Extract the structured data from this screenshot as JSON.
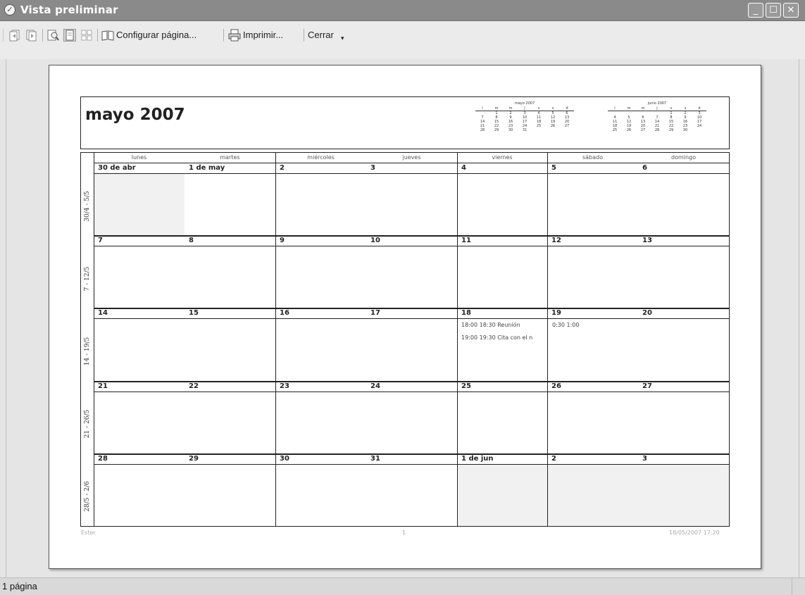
{
  "window": {
    "title": "Vista preliminar"
  },
  "toolbar": {
    "page_setup": "Configurar página...",
    "print": "Imprimir...",
    "close": "Cerrar"
  },
  "calendar": {
    "title": "mayo 2007",
    "mini_months": [
      {
        "title": "mayo 2007",
        "headers": [
          "l",
          "m",
          "m",
          "j",
          "v",
          "s",
          "d"
        ],
        "rows": [
          [
            "",
            "1",
            "2",
            "3",
            "4",
            "5",
            "6"
          ],
          [
            "7",
            "8",
            "9",
            "10",
            "11",
            "12",
            "13"
          ],
          [
            "14",
            "15",
            "16",
            "17",
            "18",
            "19",
            "20"
          ],
          [
            "21",
            "22",
            "23",
            "24",
            "25",
            "26",
            "27"
          ],
          [
            "28",
            "29",
            "30",
            "31",
            "",
            "",
            ""
          ]
        ]
      },
      {
        "title": "junio 2007",
        "headers": [
          "l",
          "m",
          "m",
          "j",
          "v",
          "s",
          "d"
        ],
        "rows": [
          [
            "",
            "",
            "",
            "",
            "1",
            "2",
            "3"
          ],
          [
            "4",
            "5",
            "6",
            "7",
            "8",
            "9",
            "10"
          ],
          [
            "11",
            "12",
            "13",
            "14",
            "15",
            "16",
            "17"
          ],
          [
            "18",
            "19",
            "20",
            "21",
            "22",
            "23",
            "24"
          ],
          [
            "25",
            "26",
            "27",
            "28",
            "29",
            "30",
            ""
          ]
        ]
      }
    ],
    "day_headers": [
      "lunes",
      "martes",
      "miércoles",
      "jueves",
      "viernes",
      "sábado",
      "domingo"
    ],
    "weeks": [
      {
        "label": "30/4 - 5/5",
        "days": [
          "30 de abr",
          "1 de may",
          "2",
          "3",
          "4",
          "5",
          "6"
        ]
      },
      {
        "label": "7 - 12/5",
        "days": [
          "7",
          "8",
          "9",
          "10",
          "11",
          "12",
          "13"
        ]
      },
      {
        "label": "14 - 19/5",
        "days": [
          "14",
          "15",
          "16",
          "17",
          "18",
          "19",
          "20"
        ]
      },
      {
        "label": "21 - 26/5",
        "days": [
          "21",
          "22",
          "23",
          "24",
          "25",
          "26",
          "27"
        ]
      },
      {
        "label": "28/5 - 2/6",
        "days": [
          "28",
          "29",
          "30",
          "31",
          "1 de jun",
          "2",
          "3"
        ]
      }
    ],
    "events": {
      "friday_18": [
        "18:00 18:30 Reunión",
        "19:00 19:30 Cita con el n"
      ],
      "saturday_19": [
        "0:30 1:00"
      ]
    }
  },
  "footer": {
    "left": "Ester",
    "center": "1",
    "right": "18/05/2007 17:20"
  },
  "status": {
    "text": "1 página"
  }
}
